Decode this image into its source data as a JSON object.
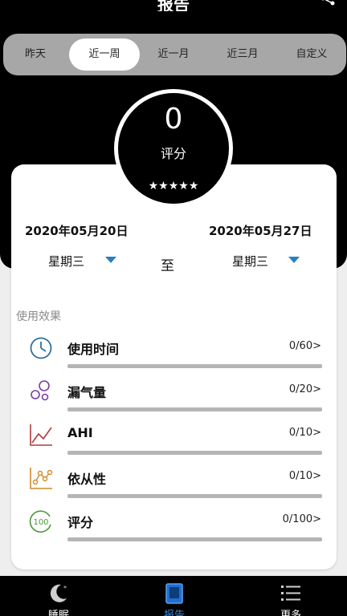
{
  "header": {
    "title": "报告"
  },
  "period_tabs": [
    {
      "label": "昨天",
      "active": false
    },
    {
      "label": "近一周",
      "active": true
    },
    {
      "label": "近一月",
      "active": false
    },
    {
      "label": "近三月",
      "active": false
    },
    {
      "label": "自定义",
      "active": false
    }
  ],
  "score": {
    "value": "0",
    "label": "评分",
    "stars": "★★★★★",
    "rating": 0
  },
  "range": {
    "start_date": "2020年05月20日",
    "end_date": "2020年05月27日",
    "start_weekday": "星期三",
    "end_weekday": "星期三",
    "separator": "至"
  },
  "section_title": "使用效果",
  "metrics": [
    {
      "name": "使用时间",
      "value": "0/60>",
      "progress": 0,
      "icon": "clock-icon",
      "color": "#2f6fa0"
    },
    {
      "name": "漏气量",
      "value": "0/20>",
      "progress": 0,
      "icon": "bubbles-icon",
      "color": "#7b3fa0"
    },
    {
      "name": "AHI",
      "value": "0/10>",
      "progress": 0,
      "icon": "line-chart-icon",
      "color": "#b23a3a"
    },
    {
      "name": "依从性",
      "value": "0/10>",
      "progress": 0,
      "icon": "scatter-chart-icon",
      "color": "#d08a2a"
    },
    {
      "name": "评分",
      "value": "0/100>",
      "progress": 0,
      "icon": "score-100-icon",
      "color": "#4a9a3a"
    }
  ],
  "bottom_nav": [
    {
      "label": "睡眠",
      "icon": "moon-icon",
      "active": false
    },
    {
      "label": "报告",
      "icon": "report-icon",
      "active": true
    },
    {
      "label": "更多",
      "icon": "list-icon",
      "active": false
    }
  ]
}
